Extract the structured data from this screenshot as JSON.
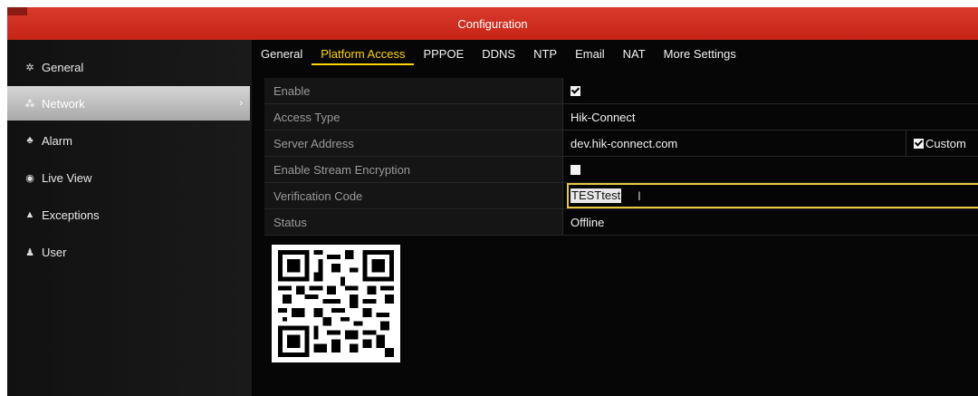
{
  "window": {
    "title": "Configuration"
  },
  "sidebar": {
    "items": [
      {
        "label": "General",
        "icon": "gear-icon",
        "glyph": "✲"
      },
      {
        "label": "Network",
        "icon": "network-icon",
        "glyph": "⁂",
        "active": true
      },
      {
        "label": "Alarm",
        "icon": "alarm-icon",
        "glyph": "♣"
      },
      {
        "label": "Live View",
        "icon": "eye-icon",
        "glyph": "◉"
      },
      {
        "label": "Exceptions",
        "icon": "warning-icon",
        "glyph": "▲"
      },
      {
        "label": "User",
        "icon": "users-icon",
        "glyph": "♟"
      }
    ]
  },
  "tabs": [
    {
      "label": "General"
    },
    {
      "label": "Platform Access",
      "active": true
    },
    {
      "label": "PPPOE"
    },
    {
      "label": "DDNS"
    },
    {
      "label": "NTP"
    },
    {
      "label": "Email"
    },
    {
      "label": "NAT"
    },
    {
      "label": "More Settings"
    }
  ],
  "form": {
    "enable": {
      "label": "Enable",
      "checked": true
    },
    "access_type": {
      "label": "Access Type",
      "value": "Hik-Connect"
    },
    "server_address": {
      "label": "Server Address",
      "value": "dev.hik-connect.com",
      "custom_label": "Custom",
      "custom_checked": true
    },
    "stream_encryption": {
      "label": "Enable Stream Encryption",
      "checked": false
    },
    "verification_code": {
      "label": "Verification Code",
      "value": "TESTtest"
    },
    "status": {
      "label": "Status",
      "value": "Offline"
    }
  },
  "colors": {
    "title_bar": "#c62416",
    "active_tab": "#ffd500",
    "input_border": "#e8c840"
  }
}
